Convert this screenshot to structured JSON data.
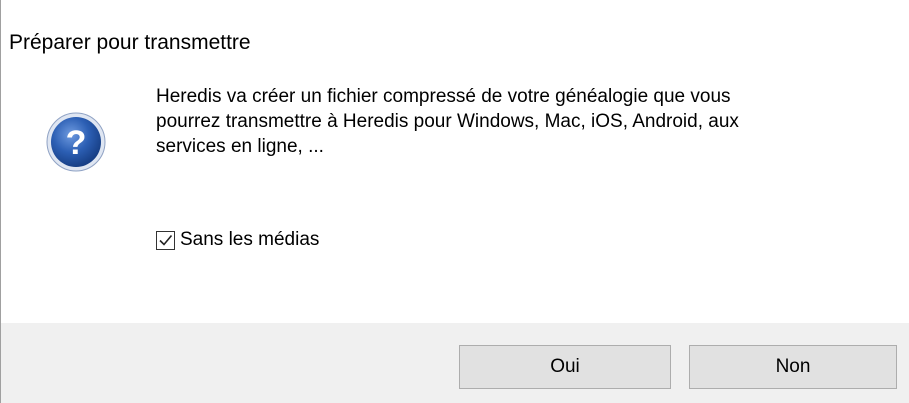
{
  "window": {
    "title": "Préparer pour transmettre"
  },
  "icon": {
    "name": "question-icon",
    "glyph": "?",
    "color": "#2c5fb4"
  },
  "message": {
    "lines": [
      "Heredis va créer un fichier compressé de votre généalogie que vous",
      "pourrez transmettre à Heredis pour Windows, Mac, iOS, Android, aux",
      "services en ligne, ..."
    ]
  },
  "options": {
    "no_media_label": "Sans les médias",
    "no_media_checked": true
  },
  "buttons": {
    "yes_label": "Oui",
    "no_label": "Non"
  },
  "colors": {
    "footer_bg": "#f0f0f0",
    "button_bg": "#e1e1e1",
    "button_border": "#adadad"
  }
}
